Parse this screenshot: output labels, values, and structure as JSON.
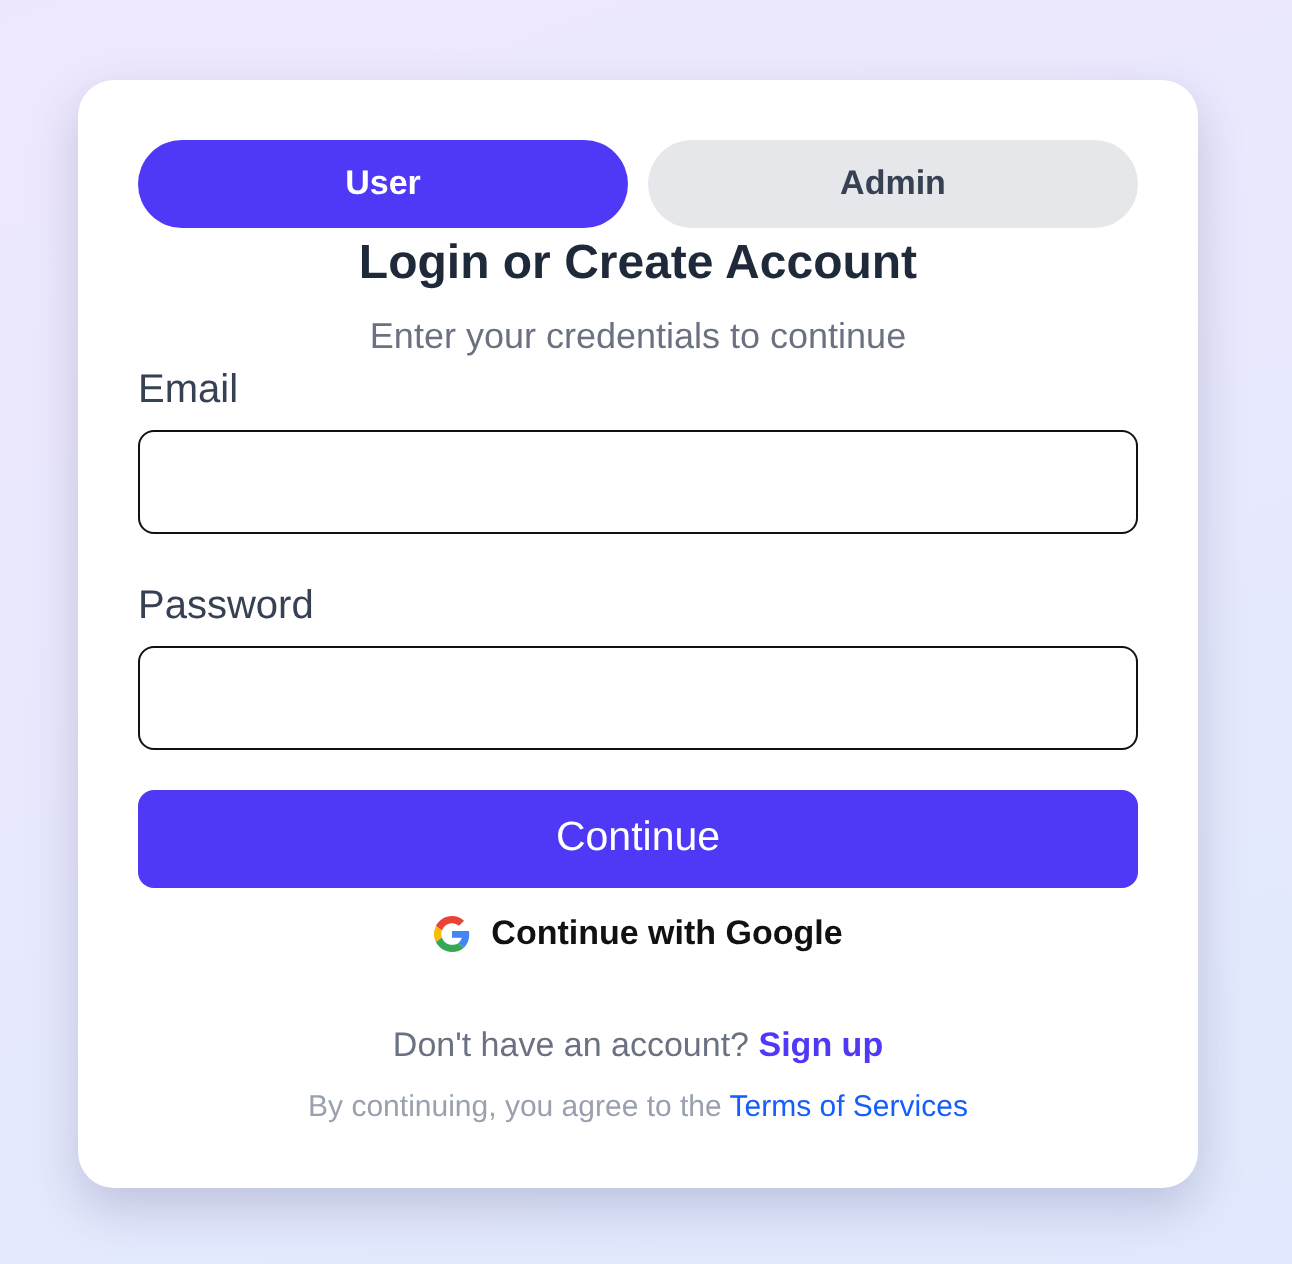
{
  "tabs": [
    {
      "label": "User",
      "selected": true
    },
    {
      "label": "Admin",
      "selected": false
    }
  ],
  "title": "Login or Create Account",
  "subtitle": "Enter your credentials to continue",
  "fields": [
    {
      "label": "Email"
    },
    {
      "label": "Password"
    }
  ],
  "submit_button": "Continue",
  "google_button": "Continue with Google",
  "signup": {
    "text": "Don't have an account?",
    "link": "Sign up"
  },
  "terms": {
    "text": "By continuing, you agree to the",
    "link": "Terms of Services"
  }
}
